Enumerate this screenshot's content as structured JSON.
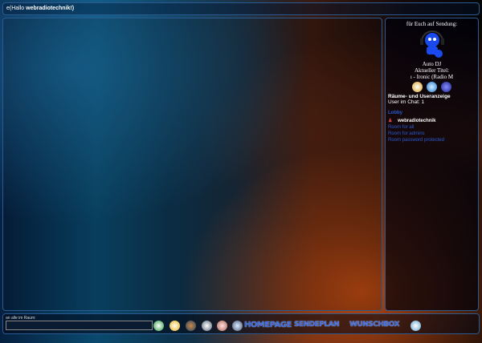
{
  "header": {
    "prefix": "e(Hallo ",
    "user": "webradiotechnik!)"
  },
  "sidebar": {
    "on_air": "für Euch auf Sendung:",
    "dj": "Auto DJ",
    "current_title_label": "Aktueller Titel:",
    "current_title": "ı - Ironic (Radio M",
    "rooms_heading": "Räume- und Useranzeige",
    "users_in_chat": "User im Chat: 1",
    "lobby": "Lobby",
    "lobby_user": "webradiotechnik",
    "rooms": [
      "Room for all",
      "Room for admins",
      "Room password protected"
    ]
  },
  "bottom": {
    "input_label": "an alle im Raum:",
    "input_value": "",
    "links": [
      "HOMEPAGE",
      "SENDEPLAN",
      "WUNSCHBOX"
    ]
  },
  "colors": {
    "border": "#2a5a90",
    "link": "#2a5ad0"
  }
}
